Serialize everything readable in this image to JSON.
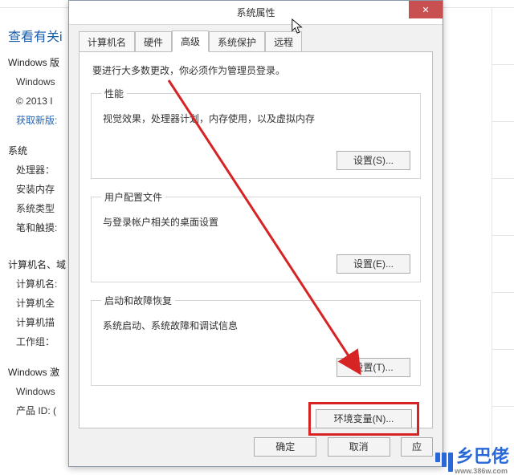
{
  "bg": {
    "title": "查看有关i",
    "items": {
      "winver": "Windows 版",
      "winsub": "Windows",
      "copyright": "© 2013 I",
      "newver": "获取新版:",
      "system": "系统",
      "cpu": "处理器：",
      "ram": "安装内存",
      "systype": "系统类型",
      "pen": "笔和触摸:",
      "domain": "计算机名、域",
      "pcname": "计算机名:",
      "pcfull": "计算机全",
      "pcdesc": "计算机描",
      "workgroup": "工作组：",
      "act": "Windows 激",
      "actsub": "Windows",
      "pid": "产品 ID: ("
    }
  },
  "dialog": {
    "title": "系统属性",
    "close": "✕",
    "tabs": {
      "t0": "计算机名",
      "t1": "硬件",
      "t2": "高级",
      "t3": "系统保护",
      "t4": "远程"
    },
    "intro": "要进行大多数更改，你必须作为管理员登录。",
    "perf": {
      "legend": "性能",
      "desc": "视觉效果，处理器计划，内存使用，以及虚拟内存",
      "btn": "设置(S)..."
    },
    "profile": {
      "legend": "用户配置文件",
      "desc": "与登录帐户相关的桌面设置",
      "btn": "设置(E)..."
    },
    "startup": {
      "legend": "启动和故障恢复",
      "desc": "系统启动、系统故障和调试信息",
      "btn": "设置(T)..."
    },
    "env_btn": "环境变量(N)...",
    "ok": "确定",
    "cancel": "取消",
    "apply": "应"
  },
  "logo": {
    "text": "乡巴佬",
    "url": "www.386w.com"
  }
}
